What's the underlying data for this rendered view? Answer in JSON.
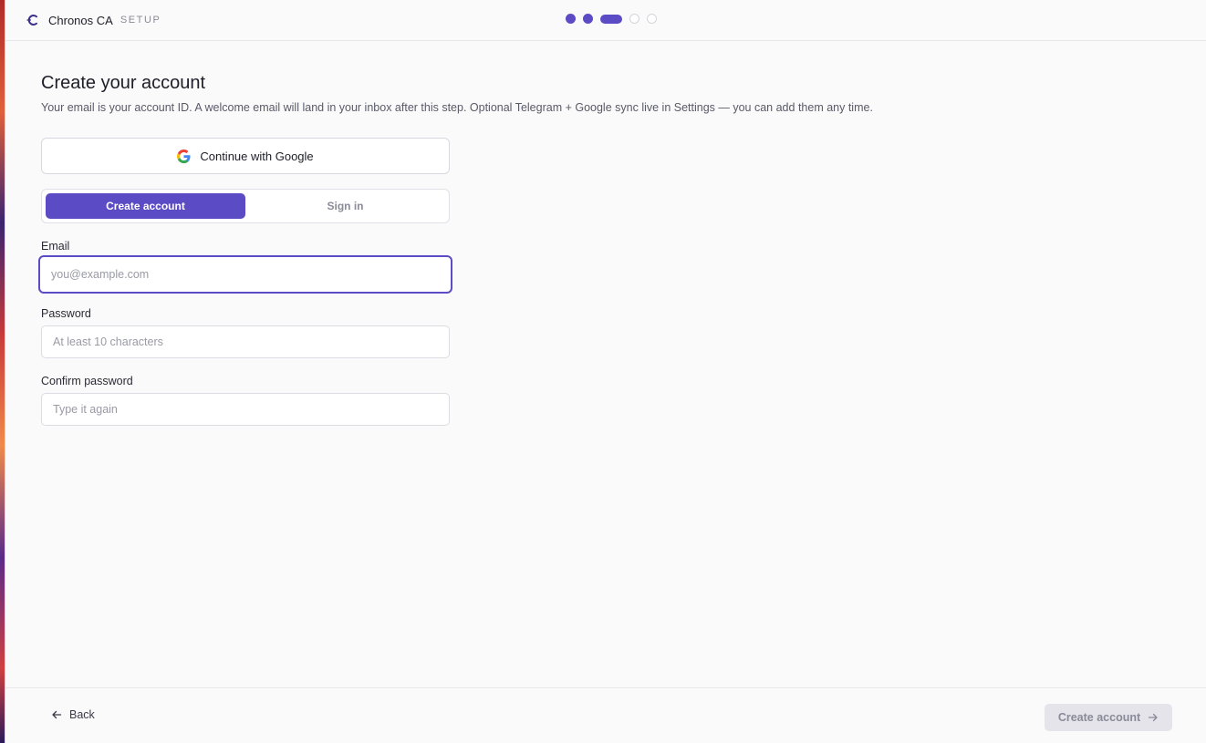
{
  "app": {
    "name": "Chronos CA",
    "stage": "SETUP"
  },
  "progress": {
    "steps_total": 5,
    "current_step": 3
  },
  "page": {
    "title": "Create your account",
    "subtitle": "Your email is your account ID. A welcome email will land in your inbox after this step. Optional Telegram + Google sync live in Settings — you can add them any time."
  },
  "google": {
    "label": "Continue with Google",
    "icon": "google-icon"
  },
  "mode": {
    "create_label": "Create account",
    "signin_label": "Sign in",
    "selected": "Create account"
  },
  "form": {
    "email_label": "Email",
    "email_placeholder": "you@example.com",
    "email_value": "",
    "password_label": "Password",
    "password_placeholder": "At least 10 characters",
    "password_value": "",
    "confirm_label": "Confirm password",
    "confirm_placeholder": "Type it again",
    "confirm_value": ""
  },
  "footer": {
    "back_label": "Back",
    "next_label": "Create account",
    "next_disabled": true
  },
  "colors": {
    "accent": "#5b4bc4",
    "background": "#fafafa",
    "text": "#1e1e28",
    "muted": "#8a8a98"
  }
}
